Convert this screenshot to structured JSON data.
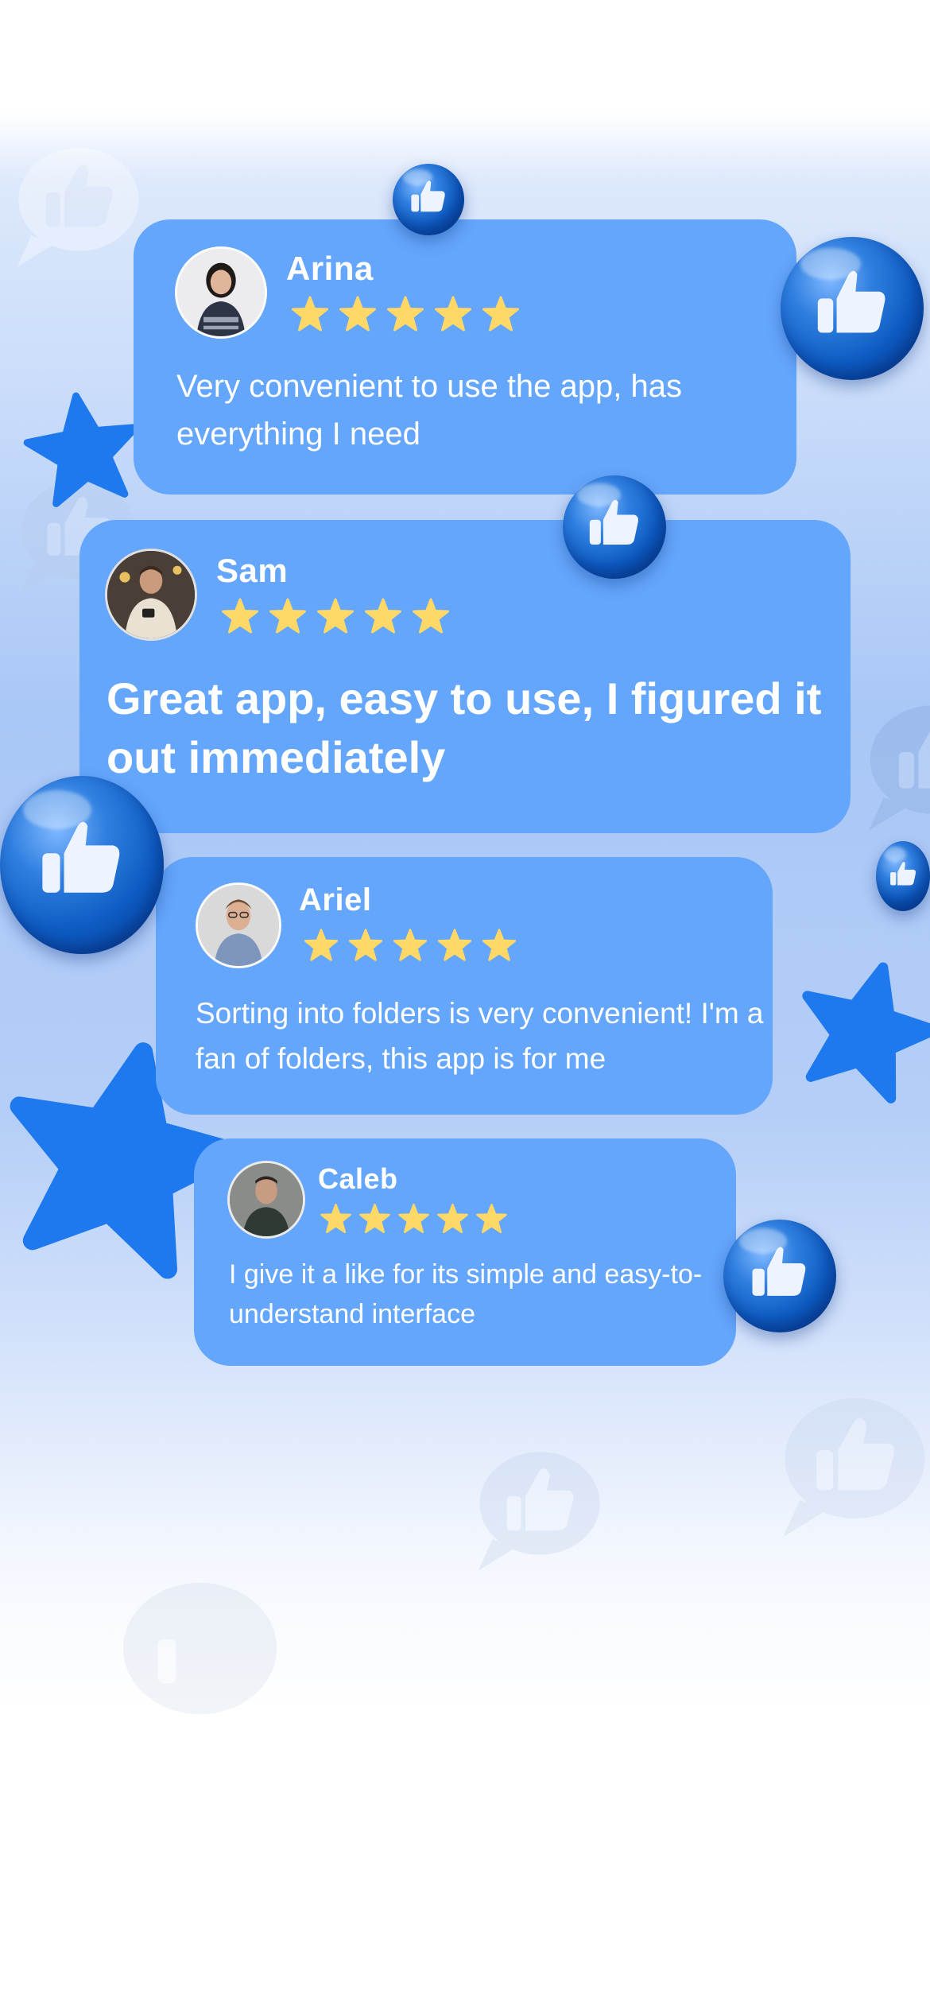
{
  "colors": {
    "card": "#64a6fb",
    "star": "#ffd867",
    "accent_star": "#1e78ee",
    "text": "#ffffff"
  },
  "icons": {
    "like_ball": "thumbs-up-icon",
    "rating": "star-icon",
    "decoration": "star-icon"
  },
  "reviews": [
    {
      "name": "Arina",
      "rating": 5,
      "text": "Very convenient to use the app, has everything I need"
    },
    {
      "name": "Sam",
      "rating": 5,
      "text": "Great app, easy to use, I figured it out immediately"
    },
    {
      "name": "Ariel",
      "rating": 5,
      "text": "Sorting into folders is very convenient! I'm a fan of folders, this app is for me"
    },
    {
      "name": "Caleb",
      "rating": 5,
      "text": "I give it a like for its simple and easy-to-understand interface"
    }
  ]
}
